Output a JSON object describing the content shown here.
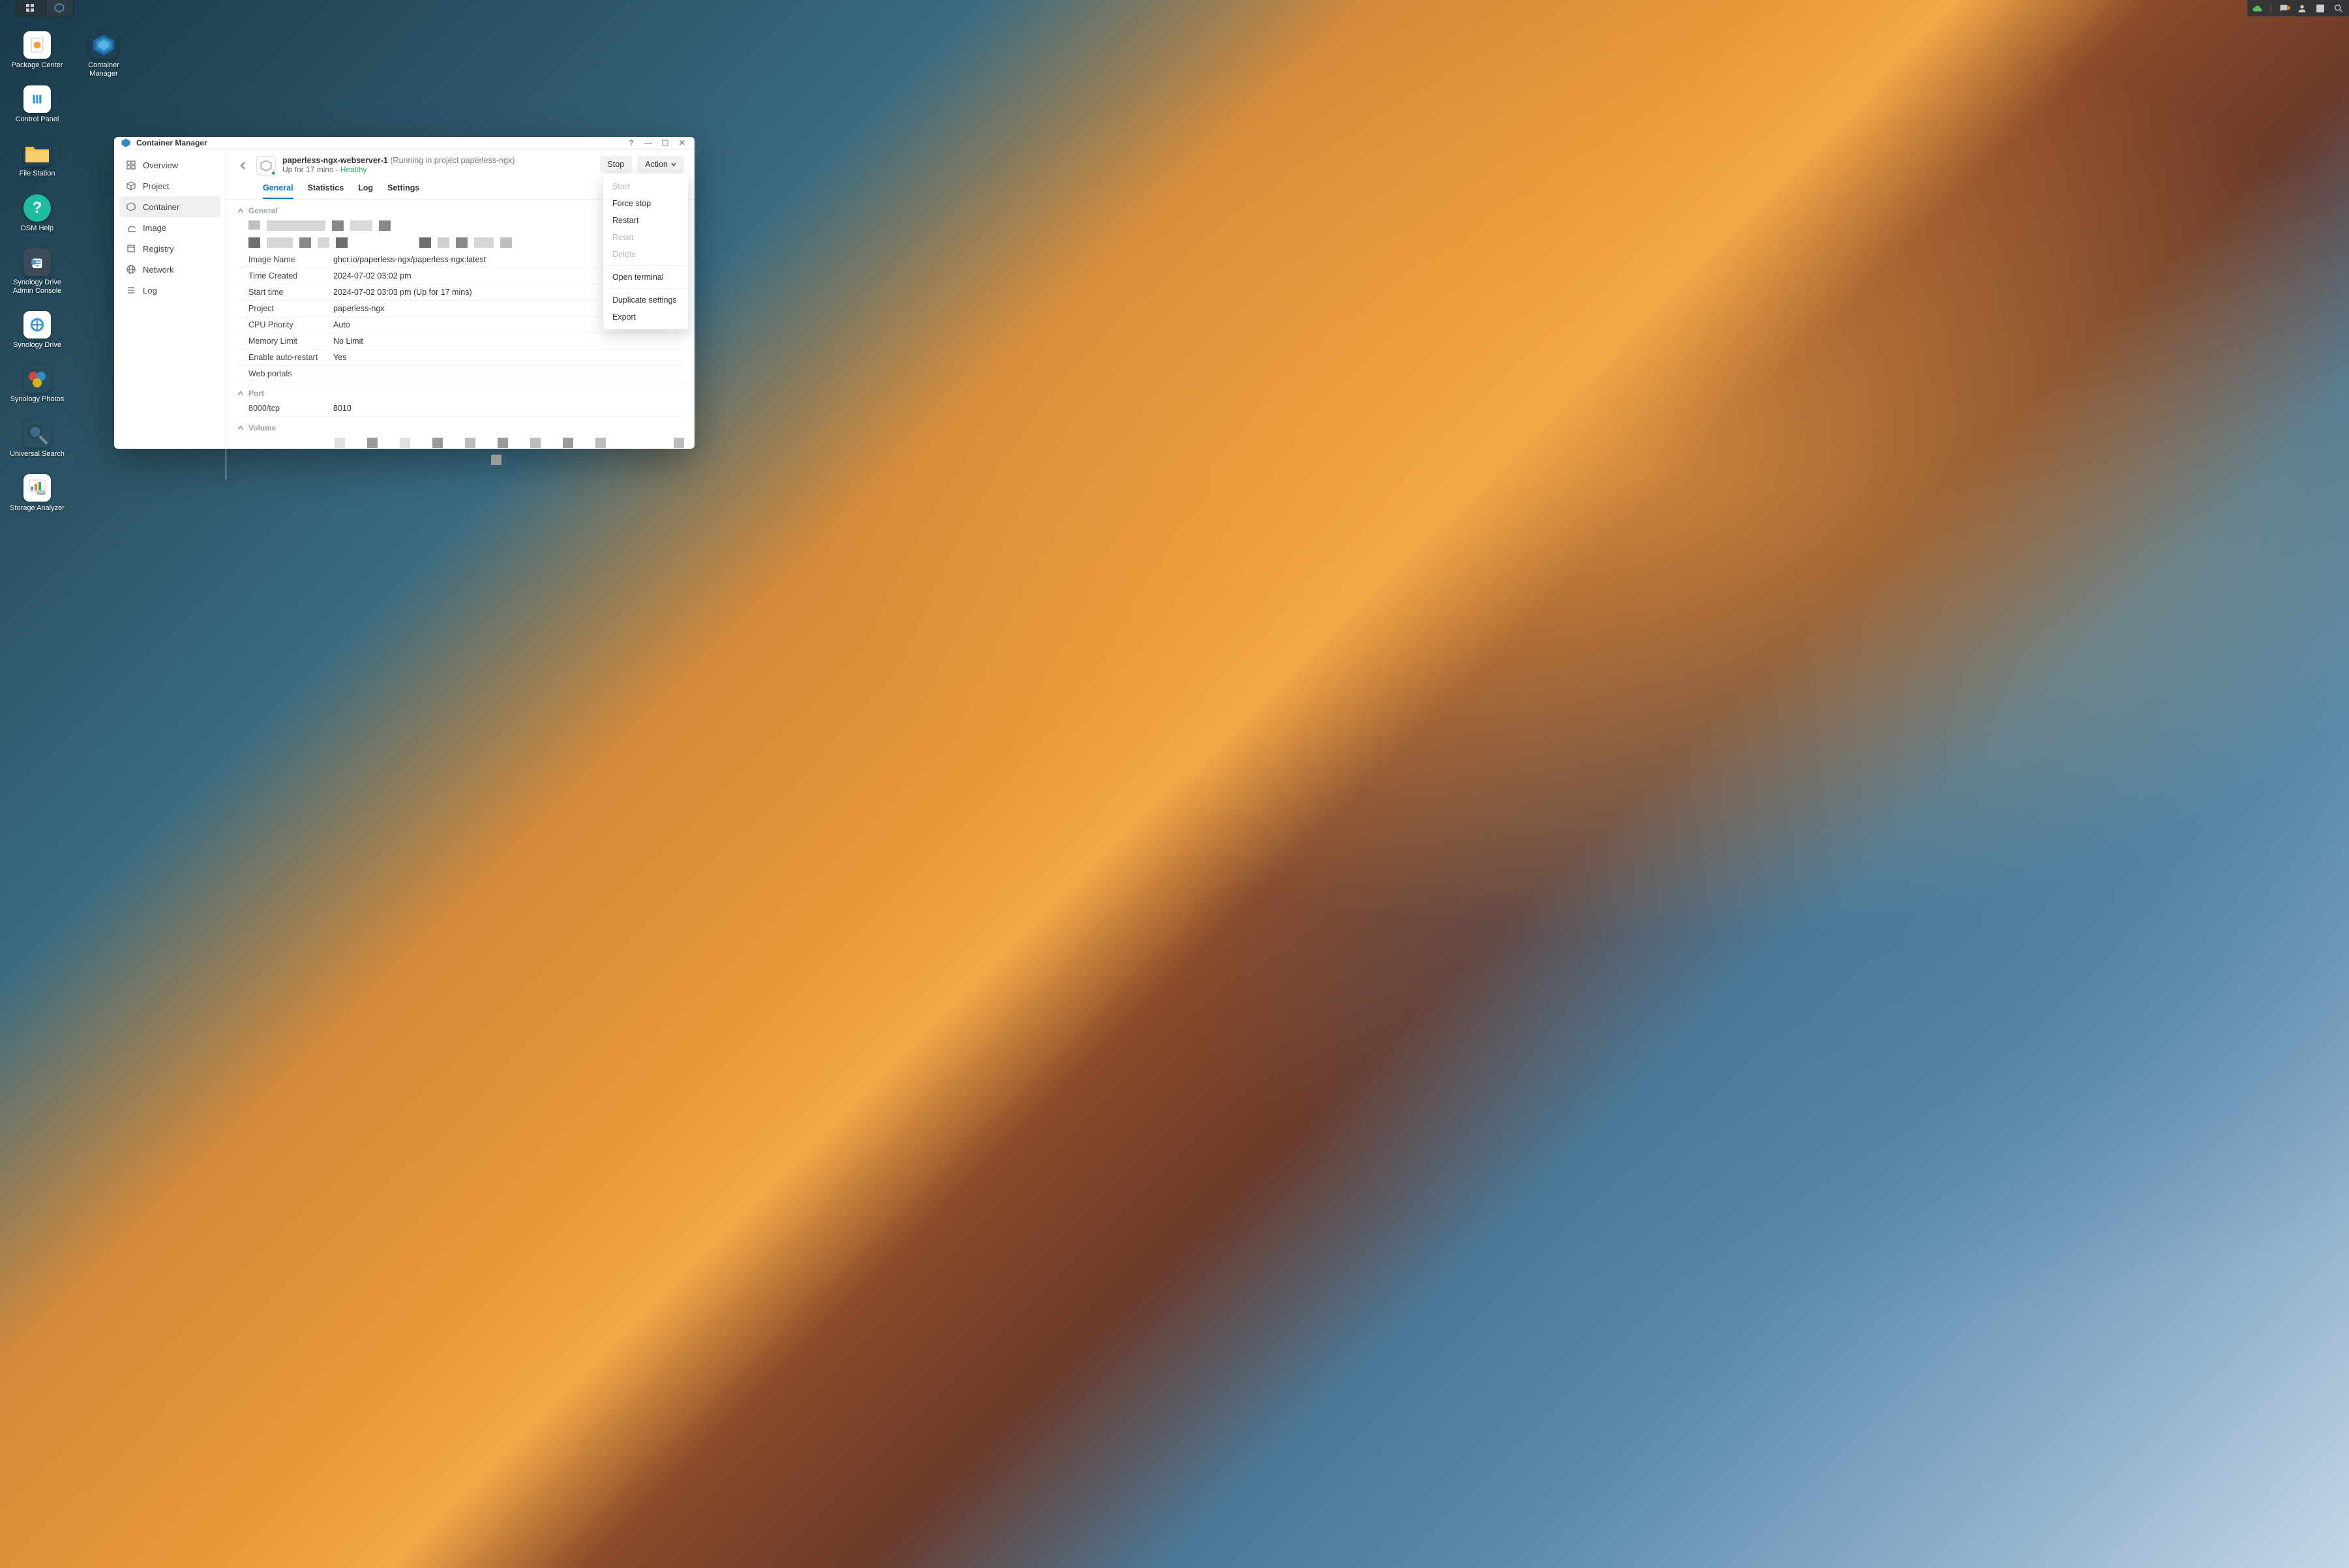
{
  "desktop": {
    "icons_col1": [
      {
        "label": "Package Center",
        "color": "#fefefe"
      },
      {
        "label": "Control Panel",
        "color": "#fefefe"
      },
      {
        "label": "File Station",
        "color": "#f6c04b"
      },
      {
        "label": "DSM Help",
        "color": "#1fbca0"
      },
      {
        "label": "Synology Drive Admin Console",
        "color": "#3b4b5a"
      },
      {
        "label": "Synology Drive",
        "color": "#fefefe"
      },
      {
        "label": "Synology Photos",
        "color": "#2a2a2a"
      },
      {
        "label": "Universal Search",
        "color": "#transparent"
      },
      {
        "label": "Storage Analyzer",
        "color": "#fefefe"
      }
    ],
    "icons_col2": [
      {
        "label": "Container Manager",
        "color": "#transparent"
      }
    ]
  },
  "window": {
    "title": "Container Manager",
    "sidebar": [
      {
        "label": "Overview",
        "icon": "overview"
      },
      {
        "label": "Project",
        "icon": "project"
      },
      {
        "label": "Container",
        "icon": "container",
        "selected": true
      },
      {
        "label": "Image",
        "icon": "image"
      },
      {
        "label": "Registry",
        "icon": "registry"
      },
      {
        "label": "Network",
        "icon": "network"
      },
      {
        "label": "Log",
        "icon": "log"
      }
    ],
    "container": {
      "name": "paperless-ngx-webserver-1",
      "running_in": "(Running in project paperless-ngx)",
      "uptime_prefix": "Up for 17 mins - ",
      "health": "Healthy",
      "stop_label": "Stop",
      "action_label": "Action"
    },
    "tabs": [
      "General",
      "Statistics",
      "Log",
      "Settings"
    ],
    "active_tab": "General",
    "sections": {
      "general_label": "General",
      "general_rows": [
        {
          "k": "Image Name",
          "v": "ghcr.io/paperless-ngx/paperless-ngx:latest"
        },
        {
          "k": "Time Created",
          "v": "2024-07-02 03:02 pm"
        },
        {
          "k": "Start time",
          "v": "2024-07-02 03:03 pm (Up for 17 mins)"
        },
        {
          "k": "Project",
          "v": "paperless-ngx"
        },
        {
          "k": "CPU Priority",
          "v": "Auto"
        },
        {
          "k": "Memory Limit",
          "v": "No Limit"
        },
        {
          "k": "Enable auto-restart",
          "v": "Yes"
        },
        {
          "k": "Web portals",
          "v": ""
        }
      ],
      "port_label": "Port",
      "port_rows": [
        {
          "k": "8000/tcp",
          "v": "8010"
        }
      ],
      "volume_label": "Volume"
    },
    "action_menu": [
      {
        "label": "Start",
        "disabled": true
      },
      {
        "label": "Force stop"
      },
      {
        "label": "Restart"
      },
      {
        "label": "Reset",
        "disabled": true
      },
      {
        "label": "Delete",
        "disabled": true
      },
      {
        "sep": true
      },
      {
        "label": "Open terminal"
      },
      {
        "sep": true
      },
      {
        "label": "Duplicate settings"
      },
      {
        "label": "Export"
      }
    ]
  }
}
